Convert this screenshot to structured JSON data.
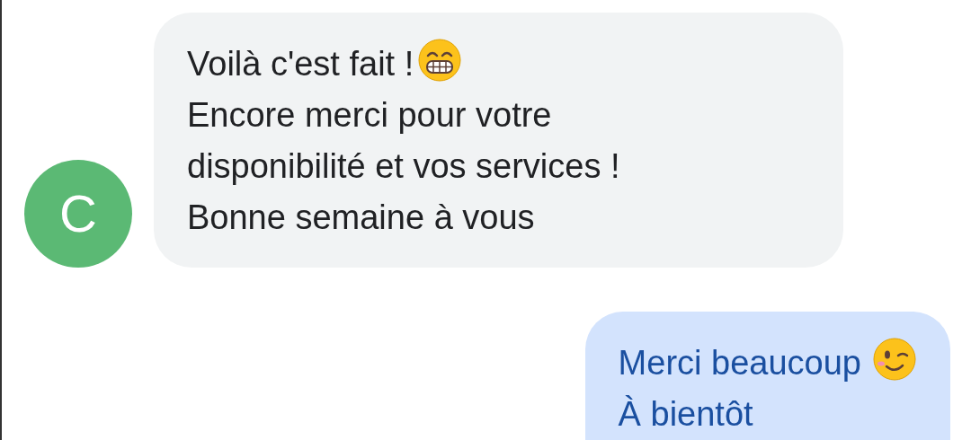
{
  "messages": [
    {
      "kind": "received",
      "avatar": "C",
      "lines": [
        {
          "text": "Voilà c'est fait !",
          "trailing_icon": true
        },
        {
          "text": "Encore merci pour votre",
          "trailing_icon": false
        },
        {
          "text": "disponibilité et vos services !",
          "trailing_icon": false
        },
        {
          "text": "Bonne semaine à vous",
          "trailing_icon": false
        }
      ]
    },
    {
      "kind": "sent",
      "lines": [
        {
          "text": "Merci beaucoup",
          "trailing_icon": true
        },
        {
          "text": "À bientôt",
          "trailing_icon": false
        }
      ]
    }
  ]
}
